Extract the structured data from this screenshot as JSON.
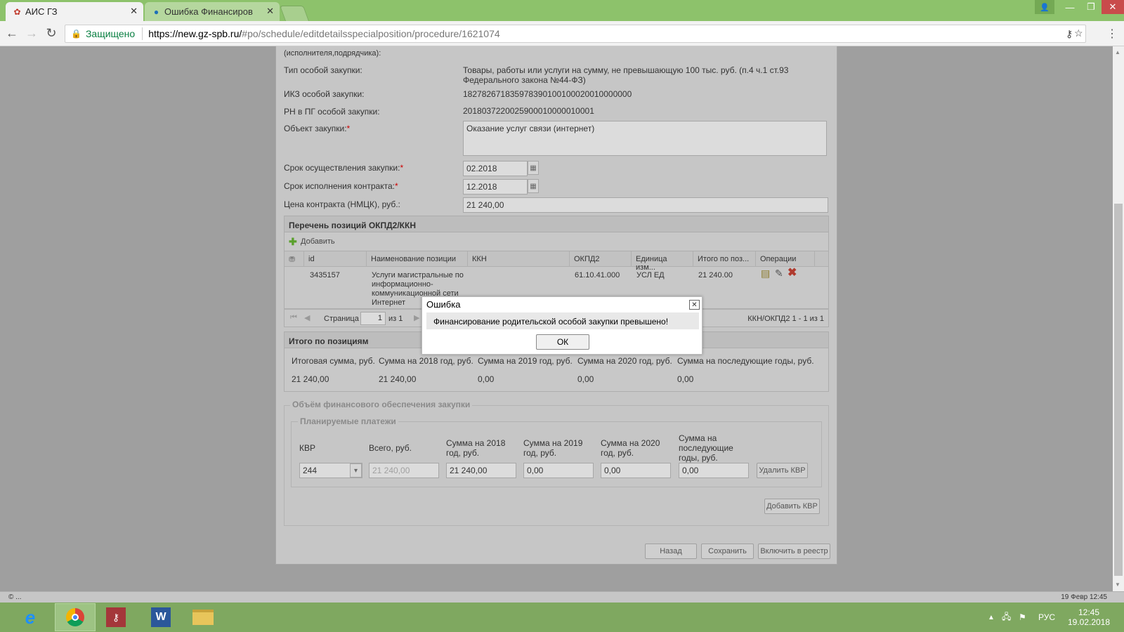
{
  "browser": {
    "tabs": [
      {
        "title": "АИС ГЗ",
        "icon": "app-icon"
      },
      {
        "title": "Ошибка Финансирован",
        "icon": "globe-icon"
      }
    ],
    "secure_label": "Защищено",
    "url_host": "https://new.gz-spb.ru/",
    "url_path": "#po/schedule/editdetailsspecialposition/procedure/1621074"
  },
  "form": {
    "top_cut_label": "(исполнителя,подрядчика):",
    "type_label": "Тип особой закупки:",
    "type_value_1": "Товары, работы или услуги на сумму, не превышающую 100 тыс. руб. (п.4 ч.1 ст.93",
    "type_value_2": "Федерального закона №44-ФЗ)",
    "ikz_label": "ИКЗ особой закупки:",
    "ikz_value": "182782671835978390100100020010000000",
    "rn_label": "РН в ПГ особой закупки:",
    "rn_value": "201803722002590001000001000­1",
    "object_label": "Объект закупки:",
    "object_value": "Оказание услуг связи (интернет)",
    "term_label": "Срок осуществления закупки:",
    "term_value": "02.2018",
    "contract_term_label": "Срок исполнения контракта:",
    "contract_term_value": "12.2018",
    "price_label": "Цена контракта (НМЦК), руб.:",
    "price_value": "21 240,00",
    "required_mark": "*"
  },
  "okpd": {
    "section_title": "Перечень позиций ОКПД2/ККН",
    "add_label": "Добавить",
    "columns": [
      "id",
      "Наименование позиции",
      "ККН",
      "ОКПД2",
      "Единица изм...",
      "Итого по поз...",
      "Операции"
    ],
    "row": {
      "id": "3435157",
      "name_1": "Услуги магистральные по",
      "name_2": "информационно-",
      "name_3": "коммуникационной сети",
      "name_4": "Интернет",
      "kkn": "",
      "okpd2": "61.10.41.000",
      "unit": "УСЛ ЕД",
      "total": "21 240.00"
    },
    "pager": {
      "page_label": "Страница",
      "page_value": "1",
      "of_label": "из 1",
      "summary": "ККН/ОКПД2 1 - 1 из 1"
    }
  },
  "totals": {
    "section_title": "Итого по позициям",
    "headers": [
      "Итоговая сумма, руб.",
      "Сумма на 2018 год, руб.",
      "Сумма на 2019 год, руб.",
      "Сумма на 2020 год, руб.",
      "Сумма на последующие годы, руб."
    ],
    "values": [
      "21 240,00",
      "21 240,00",
      "0,00",
      "0,00",
      "0,00"
    ]
  },
  "finance": {
    "legend": "Объём финансового обеспечения закупки",
    "sub_legend": "Планируемые платежи",
    "col_kvr": "КВР",
    "col_total": "Всего, руб.",
    "col_2018_1": "Сумма на 2018",
    "col_2018_2": "год, руб.",
    "col_2019_1": "Сумма на 2019",
    "col_2019_2": "год, руб.",
    "col_2020_1": "Сумма на 2020",
    "col_2020_2": "год, руб.",
    "col_next_1": "Сумма на",
    "col_next_2": "последующие",
    "col_next_3": "годы, руб.",
    "kvr_value": "244",
    "total_value": "21 240,00",
    "v2018": "21 240,00",
    "v2019": "0,00",
    "v2020": "0,00",
    "vnext": "0,00",
    "delete_kvr": "Удалить КВР",
    "add_kvr": "Добавить КВР"
  },
  "actions": {
    "back": "Назад",
    "save": "Сохранить",
    "include": "Включить в реестр"
  },
  "dialog": {
    "title": "Ошибка",
    "message": "Финансирование родительской особой закупки превышено!",
    "ok": "ОК"
  },
  "status": {
    "left": "© ...",
    "right": "19 Февр 12:45"
  },
  "taskbar": {
    "lang": "РУС",
    "time": "12:45",
    "date": "19.02.2018"
  }
}
